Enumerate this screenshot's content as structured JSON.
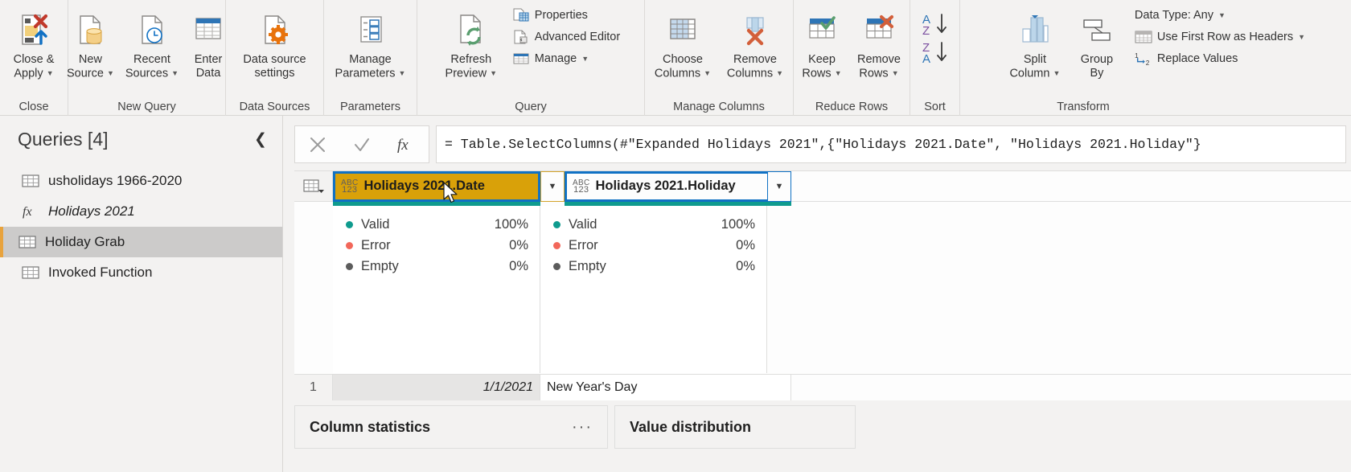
{
  "ribbon": {
    "groups": [
      {
        "label": "Close",
        "buttons": [
          {
            "name": "close-and-apply",
            "label_line1": "Close &",
            "label_line2": "Apply",
            "icon": "close-apply-icon",
            "caret": true
          }
        ]
      },
      {
        "label": "New Query",
        "buttons": [
          {
            "name": "new-source",
            "label_line1": "New",
            "label_line2": "Source",
            "icon": "new-source-icon",
            "caret": true
          },
          {
            "name": "recent-sources",
            "label_line1": "Recent",
            "label_line2": "Sources",
            "icon": "recent-sources-icon",
            "caret": true
          },
          {
            "name": "enter-data",
            "label_line1": "Enter",
            "label_line2": "Data",
            "icon": "enter-data-icon",
            "caret": false
          }
        ]
      },
      {
        "label": "Data Sources",
        "buttons": [
          {
            "name": "data-source-settings",
            "label_line1": "Data source",
            "label_line2": "settings",
            "icon": "data-source-settings-icon",
            "caret": false
          }
        ]
      },
      {
        "label": "Parameters",
        "buttons": [
          {
            "name": "manage-parameters",
            "label_line1": "Manage",
            "label_line2": "Parameters",
            "icon": "manage-parameters-icon",
            "caret": true
          }
        ]
      },
      {
        "label": "Query",
        "buttons": [
          {
            "name": "refresh-preview",
            "label_line1": "Refresh",
            "label_line2": "Preview",
            "icon": "refresh-preview-icon",
            "caret": true
          }
        ],
        "small_buttons": [
          {
            "name": "properties",
            "label": "Properties",
            "icon": "properties-icon",
            "caret": false
          },
          {
            "name": "advanced-editor",
            "label": "Advanced Editor",
            "icon": "advanced-editor-icon",
            "caret": false
          },
          {
            "name": "manage",
            "label": "Manage",
            "icon": "manage-icon",
            "caret": true
          }
        ]
      },
      {
        "label": "Manage Columns",
        "buttons": [
          {
            "name": "choose-columns",
            "label_line1": "Choose",
            "label_line2": "Columns",
            "icon": "choose-columns-icon",
            "caret": true
          },
          {
            "name": "remove-columns",
            "label_line1": "Remove",
            "label_line2": "Columns",
            "icon": "remove-columns-icon",
            "caret": true
          }
        ]
      },
      {
        "label": "Reduce Rows",
        "buttons": [
          {
            "name": "keep-rows",
            "label_line1": "Keep",
            "label_line2": "Rows",
            "icon": "keep-rows-icon",
            "caret": true
          },
          {
            "name": "remove-rows",
            "label_line1": "Remove",
            "label_line2": "Rows",
            "icon": "remove-rows-icon",
            "caret": true
          }
        ]
      },
      {
        "label": "Sort",
        "buttons": [
          {
            "name": "sort-ascending",
            "label_line1": "",
            "label_line2": "",
            "icon": "sort-az-icon",
            "caret": false
          }
        ]
      },
      {
        "label": "Transform",
        "buttons": [
          {
            "name": "split-column",
            "label_line1": "Split",
            "label_line2": "Column",
            "icon": "split-column-icon",
            "caret": true
          },
          {
            "name": "group-by",
            "label_line1": "Group",
            "label_line2": "By",
            "icon": "group-by-icon",
            "caret": false
          }
        ],
        "small_buttons": [
          {
            "name": "data-type",
            "label": "Data Type: Any",
            "icon": "none",
            "caret": true
          },
          {
            "name": "use-first-row-as-headers",
            "label": "Use First Row as Headers",
            "icon": "first-row-headers-icon",
            "caret": true
          },
          {
            "name": "replace-values",
            "label": "Replace Values",
            "icon": "replace-values-icon",
            "caret": false
          }
        ]
      }
    ]
  },
  "queries": {
    "title": "Queries [4]",
    "collapse_icon": "chevron-left-icon",
    "items": [
      {
        "label": "usholidays 1966-2020",
        "icon": "table-icon",
        "selected": false,
        "italic": false
      },
      {
        "label": "Holidays 2021",
        "icon": "fx-icon",
        "selected": false,
        "italic": true
      },
      {
        "label": "Holiday Grab",
        "icon": "table-icon",
        "selected": true,
        "italic": false
      },
      {
        "label": "Invoked Function",
        "icon": "table-icon",
        "selected": false,
        "italic": false
      }
    ]
  },
  "formula_bar": {
    "cancel_icon": "close-icon",
    "confirm_icon": "check-icon",
    "fx_icon": "fx-icon",
    "formula_prefix": "= Table.SelectColumns(#\"Expanded Holidays 2021\",{",
    "formula_arg1": "\"Holidays 2021.Date\"",
    "formula_sep": ", ",
    "formula_arg2": "\"Holidays 2021.Holiday\"",
    "formula_suffix": "}"
  },
  "grid": {
    "corner_icon": "select-all-table-icon",
    "columns": [
      {
        "name": "column-header-holidays-2021-date",
        "label": "Holidays 2021.Date",
        "type_badge": "ABC123",
        "state": "active-selected",
        "dropdown_icon": "chevron-down-icon"
      },
      {
        "name": "column-header-holidays-2021-holiday",
        "label": "Holidays 2021.Holiday",
        "type_badge": "ABC123",
        "state": "selected",
        "dropdown_icon": "chevron-down-icon"
      }
    ],
    "profiles": [
      {
        "column": "Holidays 2021.Date",
        "rows": [
          {
            "label": "Valid",
            "value": "100%",
            "color": "#0f9b8e"
          },
          {
            "label": "Error",
            "value": "0%",
            "color": "#f2675a"
          },
          {
            "label": "Empty",
            "value": "0%",
            "color": "#5c5c5c"
          }
        ]
      },
      {
        "column": "Holidays 2021.Holiday",
        "rows": [
          {
            "label": "Valid",
            "value": "100%",
            "color": "#0f9b8e"
          },
          {
            "label": "Error",
            "value": "0%",
            "color": "#f2675a"
          },
          {
            "label": "Empty",
            "value": "0%",
            "color": "#5c5c5c"
          }
        ]
      }
    ],
    "rows": [
      {
        "index": "1",
        "date": "1/1/2021",
        "holiday": "New Year's Day"
      }
    ]
  },
  "bottom_panels": [
    {
      "name": "column-statistics-panel",
      "title": "Column statistics",
      "menu_icon": "ellipsis-icon",
      "has_menu": true
    },
    {
      "name": "value-distribution-panel",
      "title": "Value distribution",
      "menu_icon": "ellipsis-icon",
      "has_menu": false
    }
  ],
  "colors": {
    "accent_selection": "#1071c4",
    "active_column": "#d9a109",
    "valid": "#0f9b8e",
    "error": "#f2675a",
    "empty": "#5c5c5c",
    "selected_query": "#e8a33d"
  }
}
